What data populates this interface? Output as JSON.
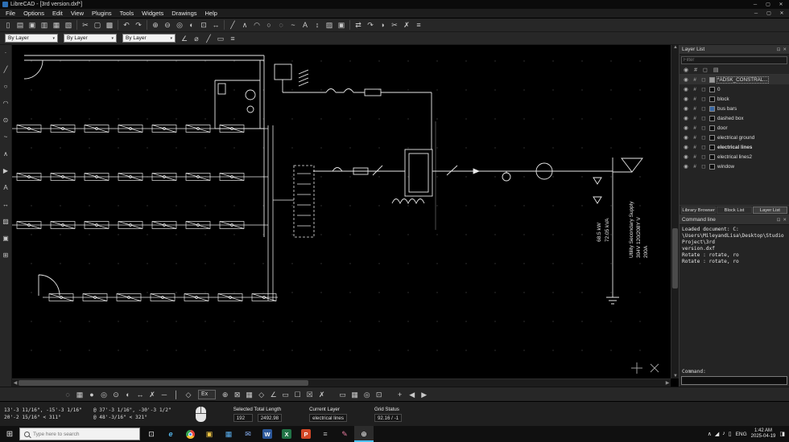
{
  "window": {
    "title": "LibreCAD - [3rd version.dxf*]",
    "controls": [
      {
        "name": "minimize",
        "glyph": "─"
      },
      {
        "name": "maximize",
        "glyph": "▢"
      },
      {
        "name": "close",
        "glyph": "✕"
      }
    ]
  },
  "menubar": [
    "File",
    "Options",
    "Edit",
    "View",
    "Plugins",
    "Tools",
    "Widgets",
    "Drawings",
    "Help"
  ],
  "toolbar_main": [
    {
      "name": "new-document",
      "glyph": "▯"
    },
    {
      "name": "open-file",
      "glyph": "▤"
    },
    {
      "name": "save",
      "glyph": "▣"
    },
    {
      "name": "save-as",
      "glyph": "▥"
    },
    {
      "name": "print",
      "glyph": "▦"
    },
    {
      "name": "print-preview",
      "glyph": "▧"
    },
    "|",
    {
      "name": "cut",
      "glyph": "✂"
    },
    {
      "name": "copy",
      "glyph": "▢"
    },
    {
      "name": "paste",
      "glyph": "▩"
    },
    "|",
    {
      "name": "undo",
      "glyph": "↶"
    },
    {
      "name": "redo",
      "glyph": "↷"
    },
    "|",
    {
      "name": "zoom-in",
      "glyph": "⊕"
    },
    {
      "name": "zoom-out",
      "glyph": "⊖"
    },
    {
      "name": "zoom-auto",
      "glyph": "◎"
    },
    {
      "name": "zoom-previous",
      "glyph": "◐"
    },
    {
      "name": "zoom-window",
      "glyph": "⊡"
    },
    {
      "name": "zoom-pan",
      "glyph": "↔"
    },
    "|",
    {
      "name": "draw-line",
      "glyph": "╱"
    },
    {
      "name": "draw-polyline",
      "glyph": "∧"
    },
    {
      "name": "draw-arc",
      "glyph": "◠"
    },
    {
      "name": "draw-circle",
      "glyph": "○"
    },
    {
      "name": "draw-ellipse",
      "glyph": "◌"
    },
    {
      "name": "draw-spline",
      "glyph": "~"
    },
    {
      "name": "draw-text",
      "glyph": "A"
    },
    {
      "name": "dimension",
      "glyph": "↕"
    },
    {
      "name": "hatch",
      "glyph": "▨"
    },
    {
      "name": "insert-image",
      "glyph": "▣"
    },
    "|",
    {
      "name": "modify-move",
      "glyph": "⇄"
    },
    {
      "name": "modify-rotate",
      "glyph": "↷"
    },
    {
      "name": "modify-mirror",
      "glyph": "◑"
    },
    {
      "name": "modify-trim",
      "glyph": "✂"
    },
    {
      "name": "modify-delete",
      "glyph": "✗"
    },
    {
      "name": "properties",
      "glyph": "≡"
    }
  ],
  "pen_toolbar": {
    "combos": [
      {
        "name": "pen-color-select",
        "value": "By Layer"
      },
      {
        "name": "pen-width-select",
        "value": "By Layer"
      },
      {
        "name": "pen-linetype-select",
        "value": "By Layer"
      }
    ],
    "icons": [
      {
        "name": "angle-tool",
        "glyph": "∠"
      },
      {
        "name": "diameter-tool",
        "glyph": "⌀"
      },
      {
        "name": "line-attr",
        "glyph": "╱"
      },
      {
        "name": "rect-attr",
        "glyph": "▭"
      },
      {
        "name": "list-attr",
        "glyph": "≡"
      }
    ]
  },
  "left_toolbar": [
    {
      "name": "tool-point",
      "glyph": "·"
    },
    {
      "name": "tool-line",
      "glyph": "╱"
    },
    {
      "name": "tool-circle",
      "glyph": "○"
    },
    {
      "name": "tool-arc",
      "glyph": "◠"
    },
    {
      "name": "tool-ellipse",
      "glyph": "⊙"
    },
    {
      "name": "tool-spline",
      "glyph": "~"
    },
    {
      "name": "tool-polyline",
      "glyph": "∧"
    },
    {
      "name": "tool-select",
      "glyph": "▶"
    },
    {
      "name": "tool-text",
      "glyph": "A"
    },
    {
      "name": "tool-dimension",
      "glyph": "↔"
    },
    {
      "name": "tool-hatch",
      "glyph": "▨"
    },
    {
      "name": "tool-image",
      "glyph": "▣"
    },
    {
      "name": "tool-block",
      "glyph": "⊞"
    }
  ],
  "snap_toolbar": {
    "group1": [
      {
        "name": "snap-free",
        "glyph": "◌"
      },
      {
        "name": "snap-grid",
        "glyph": "▦"
      },
      {
        "name": "snap-endpoint",
        "glyph": "●"
      },
      {
        "name": "snap-on-entity",
        "glyph": "◎"
      },
      {
        "name": "snap-center",
        "glyph": "⊙"
      },
      {
        "name": "snap-middle",
        "glyph": "◐"
      },
      {
        "name": "snap-distance",
        "glyph": "↔"
      },
      {
        "name": "snap-intersection",
        "glyph": "✗"
      },
      {
        "name": "restrict-horizontal",
        "glyph": "─"
      },
      {
        "name": "restrict-vertical",
        "glyph": "│"
      },
      {
        "name": "restrict-nothing",
        "glyph": "◇"
      }
    ],
    "ex_label": "Ex",
    "group2": [
      {
        "name": "set-relative-zero",
        "glyph": "⊕"
      },
      {
        "name": "lock-relative-zero",
        "glyph": "⊠"
      },
      {
        "name": "toggle-grid",
        "glyph": "▦"
      },
      {
        "name": "isometric-grid",
        "glyph": "◇"
      },
      {
        "name": "ortho-mode",
        "glyph": "∠"
      },
      {
        "name": "select-window",
        "glyph": "▭"
      },
      {
        "name": "deselect-all",
        "glyph": "☐"
      },
      {
        "name": "invert-selection",
        "glyph": "☒"
      },
      {
        "name": "kill-actions",
        "glyph": "✗"
      }
    ],
    "group3": [
      {
        "name": "draft-mode",
        "glyph": "▭"
      },
      {
        "name": "grid-settings",
        "glyph": "▦"
      },
      {
        "name": "units-toggle",
        "glyph": "◎"
      },
      {
        "name": "fullscreen-toggle",
        "glyph": "⊡"
      }
    ],
    "nav": [
      {
        "name": "add-toolbar",
        "glyph": "+"
      },
      {
        "name": "nav-previous",
        "glyph": "◀"
      },
      {
        "name": "nav-next",
        "glyph": "▶"
      }
    ]
  },
  "canvas": {
    "texts": {
      "load_kw": "68.5 kW",
      "load_kva": "72.05 kVA",
      "utility_line1": "Utility Secondary Supply",
      "utility_line2": "304V 120/208Y V",
      "utility_line3": "200A"
    }
  },
  "layer_panel": {
    "title": "Layer List",
    "filter_placeholder": "Filter",
    "header_icons": [
      {
        "name": "visibility-icon",
        "glyph": "◉"
      },
      {
        "name": "construction-icon",
        "glyph": "#"
      },
      {
        "name": "lock-icon",
        "glyph": "◻"
      },
      {
        "name": "print-icon",
        "glyph": "▤"
      }
    ],
    "layers": [
      {
        "name": "*ADSK_CONSTRAL...",
        "color": "#9a9a9a",
        "selected": true
      },
      {
        "name": "0",
        "color": "#0d0d0d"
      },
      {
        "name": "block",
        "color": "#0d0d0d"
      },
      {
        "name": "bus bars",
        "color": "#3465a4"
      },
      {
        "name": "dashed box",
        "color": "#0d0d0d"
      },
      {
        "name": "door",
        "color": "#0d0d0d"
      },
      {
        "name": "electrical ground",
        "color": "#0d0d0d"
      },
      {
        "name": "electrical lines",
        "color": "#0d0d0d",
        "current": true
      },
      {
        "name": "electrical lines2",
        "color": "#0d0d0d"
      },
      {
        "name": "window",
        "color": "#0d0d0d"
      }
    ]
  },
  "dock_tabs": [
    {
      "label": "Library Browser"
    },
    {
      "label": "Block List"
    },
    {
      "label": "Layer List",
      "active": true
    }
  ],
  "command_panel": {
    "title": "Command line",
    "log": [
      "Loaded document: C:",
      "\\Users\\MileyandLisa\\Desktop\\Studio Project\\3rd",
      "version.dxf",
      "Rotate : rotate, ro",
      "Rotate : rotate, ro"
    ],
    "prompt": "Command:"
  },
  "statusbar": {
    "abs_coord": "13'-3 11/16\", -15'-3 1/16\"",
    "abs_polar": "20'-2 15/16\" < 311°",
    "rel_coord": "@ 37'-3 1/16\", -30'-3 1/2\"",
    "rel_polar": "@ 48'-3/16\" < 321°",
    "selected_label": "Selected Total Length",
    "selected_count": "192",
    "selected_length": "2492.98",
    "layer_label": "Current Layer",
    "layer_value": "electrical lines",
    "grid_label": "Grid Status",
    "grid_value": "92.16 / -1"
  },
  "taskbar": {
    "search_placeholder": "Type here to search",
    "apps": [
      {
        "name": "task-view",
        "glyph": "⊡",
        "kind": "glyph",
        "color": "#e8e8e8"
      },
      {
        "name": "edge",
        "glyph": "e",
        "kind": "glyph",
        "color": "#53b4e8"
      },
      {
        "name": "chrome",
        "glyph": "",
        "kind": "chrome",
        "color": ""
      },
      {
        "name": "file-explorer",
        "glyph": "▣",
        "kind": "glyph",
        "color": "#f3c844"
      },
      {
        "name": "photos",
        "glyph": "▦",
        "kind": "glyph",
        "color": "#5ab0f0"
      },
      {
        "name": "mail",
        "glyph": "✉",
        "kind": "glyph",
        "color": "#8ab4f8"
      },
      {
        "name": "word",
        "glyph": "W",
        "kind": "badge",
        "color": "#2b579a"
      },
      {
        "name": "excel",
        "glyph": "X",
        "kind": "badge",
        "color": "#217346"
      },
      {
        "name": "powerpoint",
        "glyph": "P",
        "kind": "badge",
        "color": "#d24726"
      },
      {
        "name": "calculator",
        "glyph": "≡",
        "kind": "glyph",
        "color": "#b8b8b8"
      },
      {
        "name": "paint",
        "glyph": "✎",
        "kind": "glyph",
        "color": "#e87ca0"
      },
      {
        "name": "librecad",
        "glyph": "⊕",
        "kind": "glyph",
        "color": "#ffffff",
        "active": true
      }
    ],
    "tray": {
      "icons": [
        {
          "name": "tray-expand-icon",
          "glyph": "∧"
        },
        {
          "name": "network-icon",
          "glyph": "◢"
        },
        {
          "name": "volume-icon",
          "glyph": "♪"
        },
        {
          "name": "battery-icon",
          "glyph": "▯"
        }
      ],
      "lang": "ENG",
      "time": "1:42 AM",
      "date": "2025-04-19",
      "notification_glyph": "◨"
    }
  }
}
